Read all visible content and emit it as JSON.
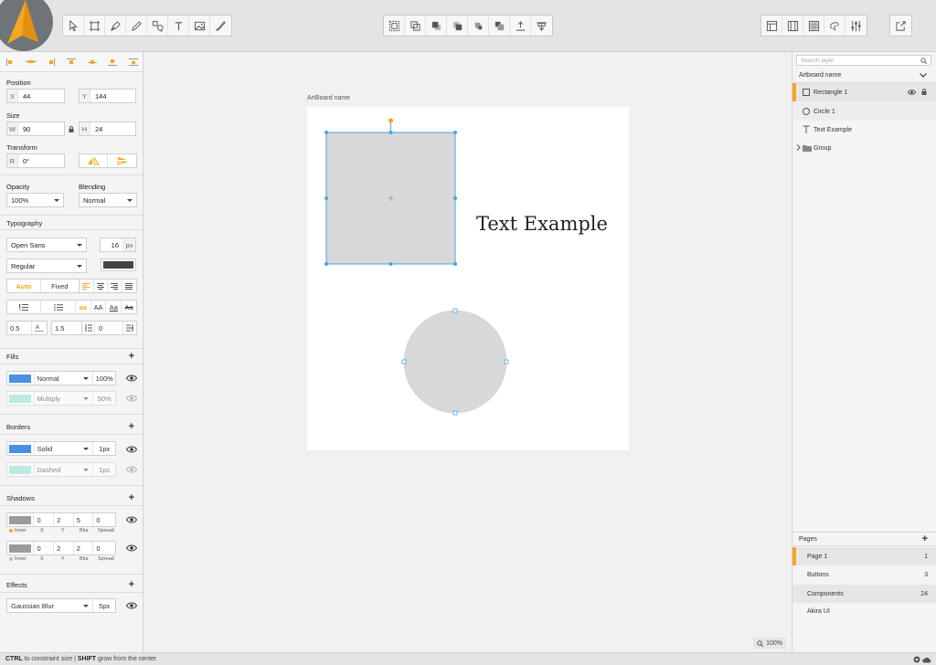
{
  "toolbar": {
    "tools": [
      {
        "icon": "cursor-icon"
      },
      {
        "icon": "artboard-icon"
      },
      {
        "icon": "pen-icon"
      },
      {
        "icon": "pencil-icon"
      },
      {
        "icon": "shapes-icon"
      },
      {
        "icon": "text-icon"
      },
      {
        "icon": "image-icon"
      },
      {
        "icon": "brush-icon"
      }
    ],
    "arrange": [
      {
        "icon": "group-icon"
      },
      {
        "icon": "ungroup-icon"
      },
      {
        "icon": "bring-forward-icon"
      },
      {
        "icon": "send-backward-icon"
      },
      {
        "icon": "bring-to-front-icon"
      },
      {
        "icon": "send-to-back-icon"
      },
      {
        "icon": "align-top-icon"
      },
      {
        "icon": "distribute-icon"
      }
    ],
    "view": [
      {
        "icon": "layout-left-icon"
      },
      {
        "icon": "layout-columns-icon"
      },
      {
        "icon": "grid-icon"
      },
      {
        "icon": "link-icon"
      },
      {
        "icon": "sliders-icon"
      }
    ],
    "export_icon": "export-icon"
  },
  "inspector": {
    "position_label": "Position",
    "x_prefix": "X",
    "x_value": "44",
    "y_prefix": "Y",
    "y_value": "144",
    "size_label": "Size",
    "w_prefix": "W",
    "w_value": "90",
    "h_prefix": "H",
    "h_value": "24",
    "transform_label": "Transform",
    "r_prefix": "R",
    "r_value": "0°",
    "opacity_label": "Opacity",
    "opacity_value": "100%",
    "blending_label": "Blending",
    "blending_value": "Normal",
    "typography_label": "Typography",
    "font_family": "Open Sans",
    "font_size": "16",
    "font_size_unit": "px",
    "font_weight": "Regular",
    "text_color": "#444444",
    "width_auto": "Auto",
    "width_fixed": "Fixed",
    "case_options": [
      "aa",
      "AA",
      "Aa",
      "Aa"
    ],
    "letter_spacing": "0.5",
    "line_height": "1.5",
    "paragraph_spacing": "0",
    "fills_label": "Fills",
    "fills": [
      {
        "color": "#4a90e2",
        "mode": "Normal",
        "value": "100%",
        "enabled": true
      },
      {
        "color": "#8de3d3",
        "mode": "Multiply",
        "value": "50%",
        "enabled": false
      }
    ],
    "borders_label": "Borders",
    "borders": [
      {
        "color": "#4a90e2",
        "style": "Solid",
        "width": "1px",
        "enabled": true
      },
      {
        "color": "#8de3d3",
        "style": "Dashed",
        "width": "1px",
        "enabled": false
      }
    ],
    "shadows_label": "Shadows",
    "shadows": [
      {
        "color": "#9b9b9b",
        "x": "0",
        "y": "2",
        "blur": "5",
        "spread": "0",
        "inner_color": "#f5a623",
        "enabled": true
      },
      {
        "color": "#9b9b9b",
        "x": "0",
        "y": "2",
        "blur": "2",
        "spread": "0",
        "inner_color": "#bbbbbb",
        "enabled": true
      }
    ],
    "shadow_col_labels": {
      "inner": "Inner",
      "x": "X",
      "y": "Y",
      "blur": "Blur",
      "spread": "Spread"
    },
    "effects_label": "Effects",
    "effect_type": "Gaussian Blur",
    "effect_value": "5px"
  },
  "canvas": {
    "artboard_name": "ArtBoard name",
    "text_example": "Text Example",
    "zoom": "100%"
  },
  "layers": {
    "search_placeholder": "Search layer",
    "artboard_label": "Artboard name",
    "items": [
      {
        "name": "Rectangle 1",
        "icon": "rectangle-icon"
      },
      {
        "name": "Circle 1",
        "icon": "circle-icon"
      },
      {
        "name": "Text Example",
        "icon": "text-icon"
      },
      {
        "name": "Group",
        "icon": "folder-icon"
      }
    ]
  },
  "pages": {
    "label": "Pages",
    "items": [
      {
        "name": "Page 1",
        "count": "1"
      },
      {
        "name": "Buttons",
        "count": "3"
      },
      {
        "name": "Components",
        "count": "24"
      },
      {
        "name": "Akira UI",
        "count": ""
      }
    ]
  },
  "status": {
    "key1": "CTRL",
    "text1": " to constraint size | ",
    "key2": "SHIFT",
    "text2": " grow from the center"
  },
  "colors": {
    "accent": "#f5a623",
    "selection": "#4aa3df",
    "shape_fill": "#d8d8d8"
  }
}
